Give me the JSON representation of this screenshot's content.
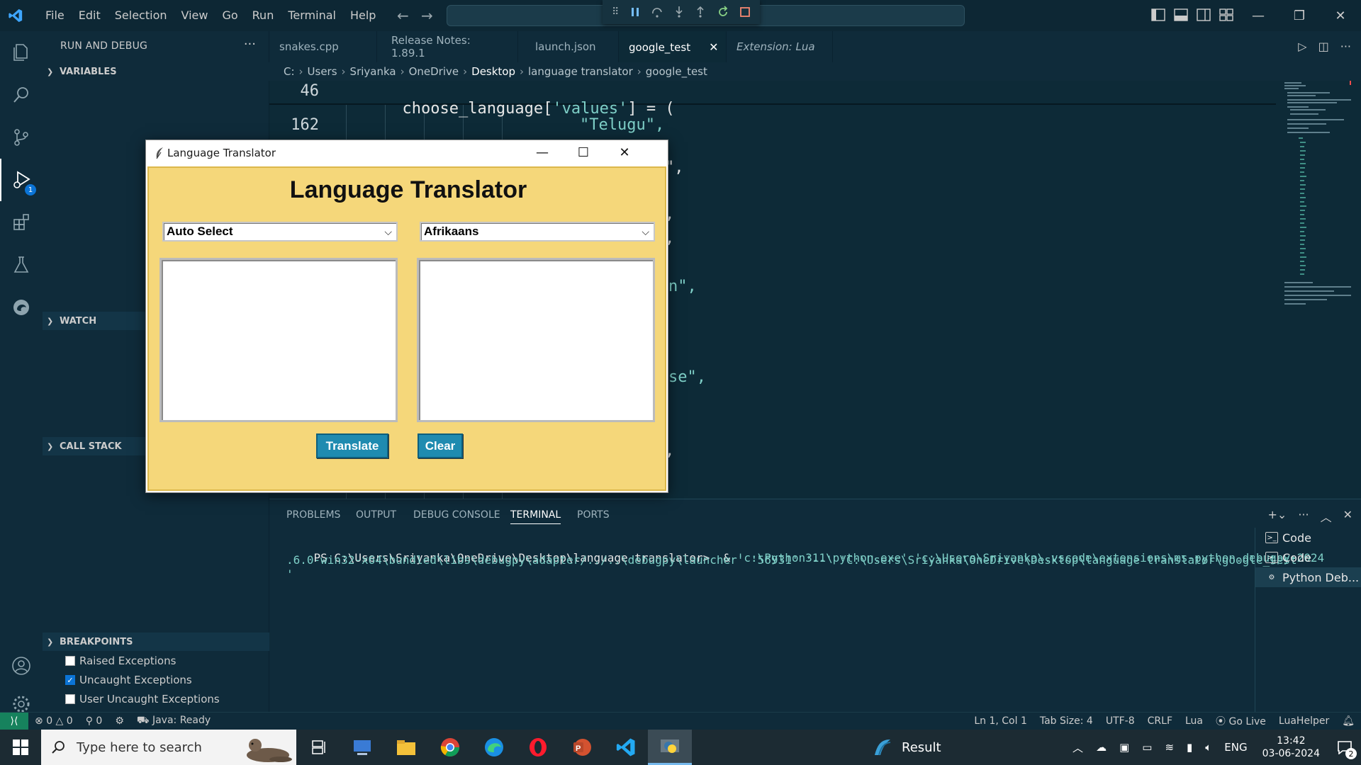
{
  "menu": [
    "File",
    "Edit",
    "Selection",
    "View",
    "Go",
    "Run",
    "Terminal",
    "Help"
  ],
  "sidebar": {
    "title": "RUN AND DEBUG",
    "more": "···",
    "sections": {
      "variables": "VARIABLES",
      "watch": "WATCH",
      "call_stack": "CALL STACK",
      "breakpoints": "BREAKPOINTS"
    },
    "breakpoints": [
      {
        "label": "Raised Exceptions",
        "checked": false
      },
      {
        "label": "Uncaught Exceptions",
        "checked": true
      },
      {
        "label": "User Uncaught Exceptions",
        "checked": false
      }
    ]
  },
  "activity": {
    "debug_badge": "1"
  },
  "tabs": [
    "snakes.cpp",
    "Release Notes: 1.89.1",
    "launch.json",
    "google_test",
    "Extension: Lua"
  ],
  "tab_close": "✕",
  "breadcrumb": [
    "C:",
    "Users",
    "Sriyanka",
    "OneDrive",
    "Desktop",
    "language translator",
    "google_test"
  ],
  "editor": {
    "sticky_line_number": "46",
    "sticky_code_plain1": "choose_language[",
    "sticky_code_str": "'values'",
    "sticky_code_plain2": "] = (",
    "line_number": "162",
    "line_code": "\"Telugu\",",
    "fragments": [
      "\",",
      ",",
      ",",
      "n\",",
      "se\",",
      ","
    ]
  },
  "panel": {
    "tabs": [
      "PROBLEMS",
      "OUTPUT",
      "DEBUG CONSOLE",
      "TERMINAL",
      "PORTS"
    ],
    "terminal_prompt": "PS C:\\Users\\Sriyanka\\OneDrive\\Desktop\\language translator>  & ",
    "terminal_cmd1": "'c:\\Python311\\python.exe' 'c:\\Users\\Sriyanka\\.vscode\\extensions\\ms-python.debugpy-2024",
    "terminal_cmd2": ".6.0-win32-x64\\bundled\\libs\\debugpy\\adapter/../..\\debugpy\\launcher' '56931' '--' 'C:\\Users\\Sriyanka\\OneDrive\\Desktop\\language translator\\google_test",
    "terminal_cmd3": "'",
    "terminals": [
      "Code",
      "Code",
      "Python Deb..."
    ]
  },
  "statusbar": {
    "errors": "0",
    "warnings": "0",
    "ports": "0",
    "java": "Java: Ready",
    "position": "Ln 1, Col 1",
    "tab_size": "Tab Size: 4",
    "encoding": "UTF-8",
    "eol": "CRLF",
    "language": "Lua",
    "golive": "Go Live",
    "luahelper": "LuaHelper"
  },
  "taskbar": {
    "search_placeholder": "Type here to search",
    "result": "Result",
    "lang": "ENG",
    "time": "13:42",
    "date": "03-06-2024",
    "notif_count": "2"
  },
  "tk": {
    "window_title": "Language Translator",
    "heading": "Language Translator",
    "source_lang": "Auto Select",
    "target_lang": "Afrikaans",
    "translate_label": "Translate",
    "clear_label": "Clear"
  },
  "colors": {
    "accent_blue": "#0b74d6",
    "tk_bg": "#f5d77a",
    "tk_button": "#1f8bb0",
    "editor_bg": "#0d2a37",
    "string": "#7ecfc7"
  }
}
